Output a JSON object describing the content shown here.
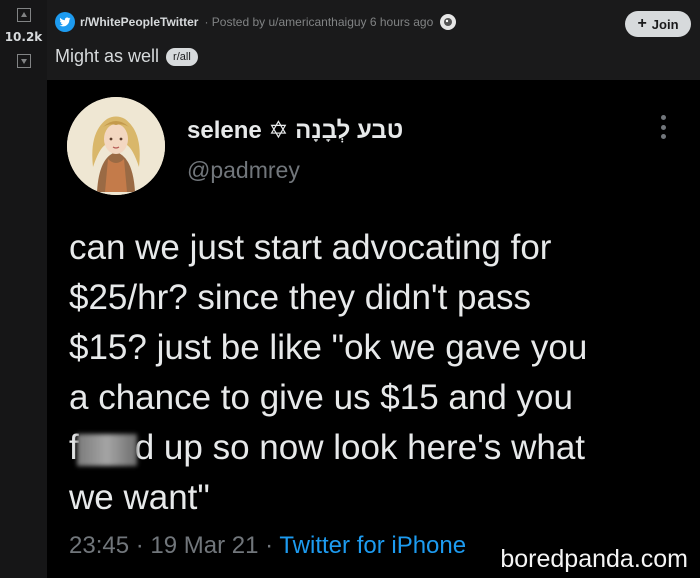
{
  "vote": {
    "score": "10.2k"
  },
  "post": {
    "subreddit": "r/WhitePeopleTwitter",
    "posted_by": "· Posted by u/americanthaiguy 6 hours ago",
    "join_label": "Join",
    "title": "Might as well",
    "flair": "r/all"
  },
  "tweet": {
    "author_name": "selene ✡ טבע לְבָנָה",
    "handle": "@padmrey",
    "lines": [
      "can we just start advocating for",
      "$25/hr? since they didn't pass",
      "$15? just be like \"ok we gave you",
      "a chance to give us $15 and you"
    ],
    "line5_start": "f",
    "line5_end": "d up so now look here's what",
    "line6": "we want\"",
    "timestamp": "23:45 · 19 Mar 21 · ",
    "source": "Twitter for iPhone"
  },
  "watermark": "boredpanda.com",
  "icons": [
    "upvote-icon",
    "downvote-icon",
    "twitter-bird-icon",
    "award-icon",
    "plus-icon",
    "more-icon"
  ]
}
